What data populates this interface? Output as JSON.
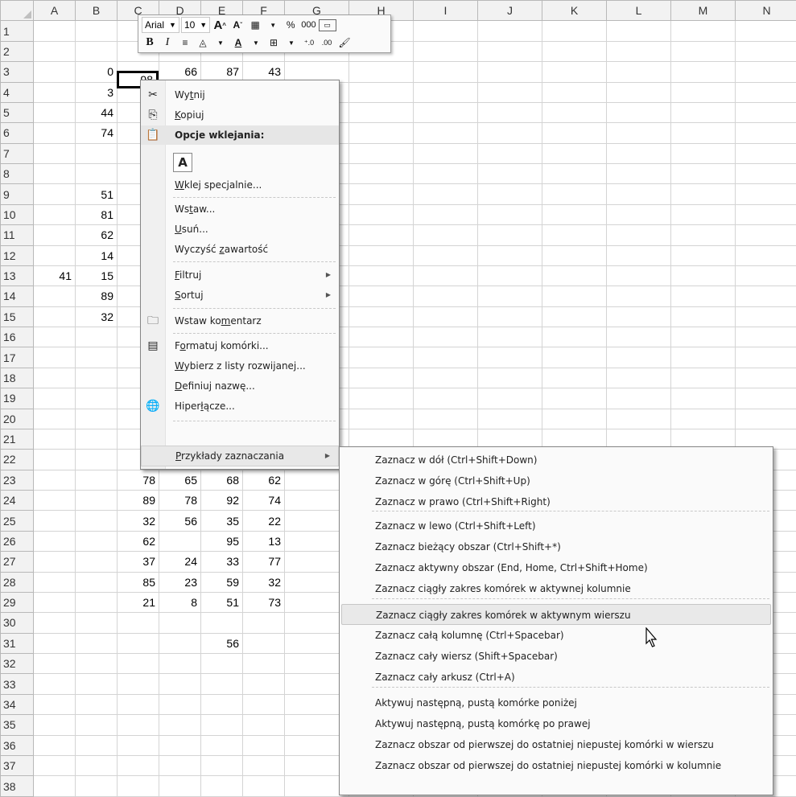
{
  "sheet": {
    "columns": [
      "A",
      "B",
      "C",
      "D",
      "E",
      "F",
      "G",
      "H",
      "I",
      "J",
      "K",
      "L",
      "M",
      "N"
    ],
    "rows": [
      {
        "n": "1",
        "cells": []
      },
      {
        "n": "2",
        "cells": []
      },
      {
        "n": "3",
        "cells": [
          [
            "B",
            "0"
          ],
          [
            "D",
            "66"
          ],
          [
            "E",
            "87"
          ],
          [
            "F",
            "43"
          ]
        ]
      },
      {
        "n": "4",
        "cells": [
          [
            "B",
            "3"
          ]
        ]
      },
      {
        "n": "5",
        "cells": [
          [
            "B",
            "44"
          ]
        ]
      },
      {
        "n": "6",
        "cells": [
          [
            "B",
            "74"
          ]
        ]
      },
      {
        "n": "7",
        "cells": []
      },
      {
        "n": "8",
        "cells": []
      },
      {
        "n": "9",
        "cells": [
          [
            "B",
            "51"
          ]
        ]
      },
      {
        "n": "10",
        "cells": [
          [
            "B",
            "81"
          ]
        ]
      },
      {
        "n": "11",
        "cells": [
          [
            "B",
            "62"
          ]
        ]
      },
      {
        "n": "12",
        "cells": [
          [
            "B",
            "14"
          ]
        ]
      },
      {
        "n": "13",
        "cells": [
          [
            "A",
            "41"
          ],
          [
            "B",
            "15"
          ]
        ]
      },
      {
        "n": "14",
        "cells": [
          [
            "B",
            "89"
          ]
        ]
      },
      {
        "n": "15",
        "cells": [
          [
            "B",
            "32"
          ]
        ]
      },
      {
        "n": "16",
        "cells": []
      },
      {
        "n": "17",
        "cells": []
      },
      {
        "n": "18",
        "cells": []
      },
      {
        "n": "19",
        "cells": []
      },
      {
        "n": "20",
        "cells": []
      },
      {
        "n": "21",
        "cells": []
      },
      {
        "n": "22",
        "cells": []
      },
      {
        "n": "23",
        "cells": [
          [
            "C",
            "78"
          ],
          [
            "D",
            "65"
          ],
          [
            "E",
            "68"
          ],
          [
            "F",
            "62"
          ]
        ]
      },
      {
        "n": "24",
        "cells": [
          [
            "C",
            "89"
          ],
          [
            "D",
            "78"
          ],
          [
            "E",
            "92"
          ],
          [
            "F",
            "74"
          ]
        ]
      },
      {
        "n": "25",
        "cells": [
          [
            "C",
            "32"
          ],
          [
            "D",
            "56"
          ],
          [
            "E",
            "35"
          ],
          [
            "F",
            "22"
          ]
        ]
      },
      {
        "n": "26",
        "cells": [
          [
            "C",
            "62"
          ],
          [
            "E",
            "95"
          ],
          [
            "F",
            "13"
          ]
        ]
      },
      {
        "n": "27",
        "cells": [
          [
            "C",
            "37"
          ],
          [
            "D",
            "24"
          ],
          [
            "E",
            "33"
          ],
          [
            "F",
            "77"
          ]
        ]
      },
      {
        "n": "28",
        "cells": [
          [
            "C",
            "85"
          ],
          [
            "D",
            "23"
          ],
          [
            "E",
            "59"
          ],
          [
            "F",
            "32"
          ]
        ]
      },
      {
        "n": "29",
        "cells": [
          [
            "C",
            "21"
          ],
          [
            "D",
            "8"
          ],
          [
            "E",
            "51"
          ],
          [
            "F",
            "73"
          ]
        ]
      },
      {
        "n": "30",
        "cells": []
      },
      {
        "n": "31",
        "cells": [
          [
            "E",
            "56"
          ]
        ]
      },
      {
        "n": "32",
        "cells": []
      },
      {
        "n": "33",
        "cells": []
      },
      {
        "n": "34",
        "cells": []
      },
      {
        "n": "35",
        "cells": []
      },
      {
        "n": "36",
        "cells": []
      },
      {
        "n": "37",
        "cells": []
      },
      {
        "n": "38",
        "cells": []
      }
    ],
    "active_cell_value": "98"
  },
  "mini_toolbar": {
    "font": "Arial",
    "size": "10",
    "percent": "%",
    "thousands": "000",
    "bold": "B",
    "italic": "I"
  },
  "context_menu": {
    "cut": {
      "pre": "Wy",
      "u": "t",
      "post": "nij"
    },
    "copy": {
      "pre": "",
      "u": "K",
      "post": "opiuj"
    },
    "paste_header": "Opcje wklejania:",
    "paste_a": "A",
    "paste_special": {
      "pre": "",
      "u": "W",
      "post": "klej specjalnie..."
    },
    "insert": {
      "pre": "Ws",
      "u": "t",
      "post": "aw..."
    },
    "delete": {
      "pre": "",
      "u": "U",
      "post": "suń..."
    },
    "clear": {
      "pre": "Wyczyść ",
      "u": "z",
      "post": "awartość"
    },
    "filter": {
      "pre": "",
      "u": "F",
      "post": "iltruj"
    },
    "sort": {
      "pre": "",
      "u": "S",
      "post": "ortuj"
    },
    "comment": {
      "pre": "Wstaw ko",
      "u": "m",
      "post": "entarz"
    },
    "format": {
      "pre": "F",
      "u": "o",
      "post": "rmatuj komórki..."
    },
    "dropdown": {
      "pre": "",
      "u": "W",
      "post": "ybierz z listy rozwijanej..."
    },
    "name": {
      "pre": "",
      "u": "D",
      "post": "efiniuj nazwę..."
    },
    "link": {
      "pre": "Hiper",
      "u": "ł",
      "post": "ącze..."
    },
    "examples": {
      "pre": "",
      "u": "P",
      "post": "rzykłady zaznaczania"
    }
  },
  "submenu": [
    "Zaznacz w dół (Ctrl+Shift+Down)",
    "Zaznacz w górę (Ctrl+Shift+Up)",
    "Zaznacz w prawo (Ctrl+Shift+Right)",
    "Zaznacz w lewo (Ctrl+Shift+Left)",
    "Zaznacz bieżący obszar (Ctrl+Shift+*)",
    "Zaznacz aktywny obszar (End, Home, Ctrl+Shift+Home)",
    "Zaznacz ciągły zakres komórek w aktywnej kolumnie",
    "Zaznacz ciągły zakres komórek w aktywnym wierszu",
    "Zaznacz całą kolumnę (Ctrl+Spacebar)",
    "Zaznacz cały wiersz (Shift+Spacebar)",
    "Zaznacz cały arkusz (Ctrl+A)",
    "Aktywuj następną, pustą komórke poniżej",
    "Aktywuj następną, pustą komórkę po prawej",
    "Zaznacz obszar od pierwszej do ostatniej niepustej komórki w wierszu",
    "Zaznacz obszar od pierwszej do ostatniej niepustej komórki w kolumnie"
  ],
  "submenu_highlight": 7
}
